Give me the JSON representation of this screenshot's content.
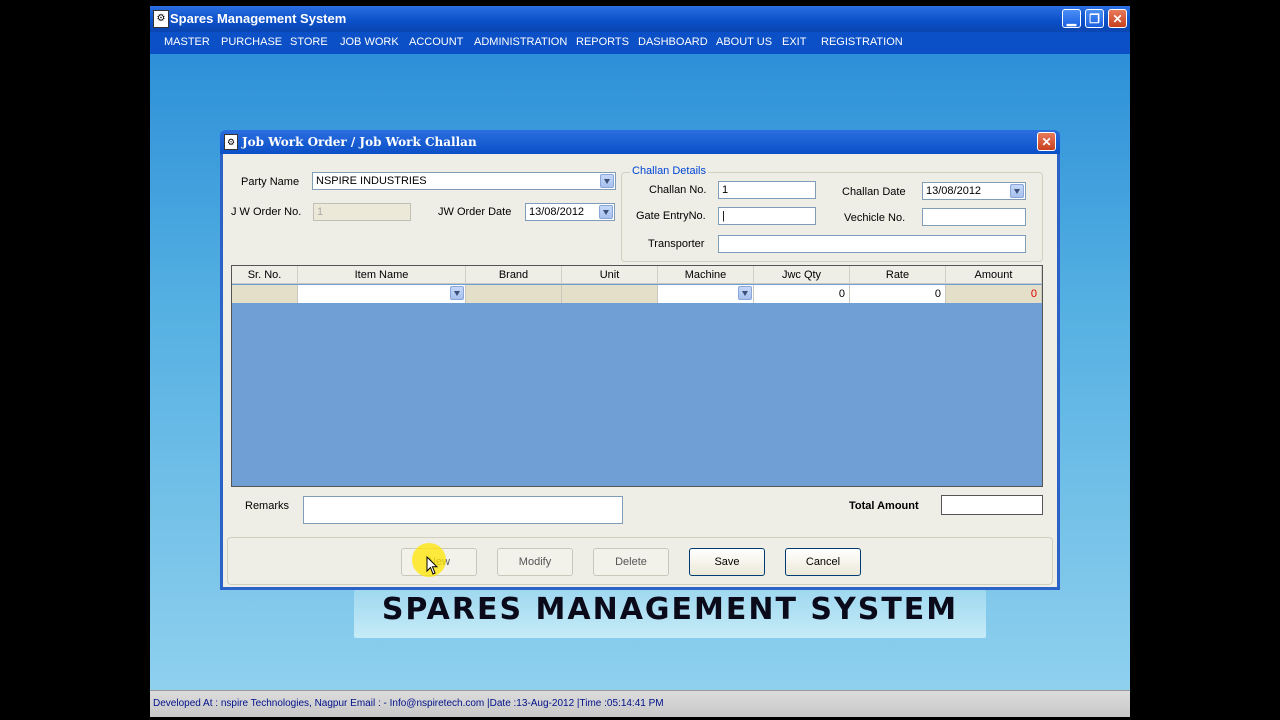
{
  "app": {
    "title": "Spares  Management System",
    "icon_text": "⚙",
    "min_glyph": "▁",
    "max_glyph": "❐",
    "close_glyph": "✕"
  },
  "menu": [
    "MASTER",
    "PURCHASE",
    "STORE",
    "JOB WORK",
    "ACCOUNT",
    "ADMINISTRATION",
    "REPORTS",
    "DASHBOARD",
    "ABOUT US",
    "EXIT",
    "REGISTRATION"
  ],
  "dialog": {
    "title": "Job Work Order / Job Work Challan",
    "close_glyph": "✕",
    "party_name_label": "Party Name",
    "party_name_value": "NSPIRE INDUSTRIES",
    "jw_order_no_label": "J W Order No.",
    "jw_order_no_value": "1",
    "jw_order_date_label": "JW Order Date",
    "jw_order_date_value": "13/08/2012",
    "challan": {
      "legend": "Challan Details",
      "challan_no_label": "Challan No.",
      "challan_no_value": "1",
      "challan_date_label": "Challan Date",
      "challan_date_value": "13/08/2012",
      "gate_entry_label": "Gate EntryNo.",
      "gate_entry_value": "|",
      "vehicle_no_label": "Vechicle No.",
      "vehicle_no_value": "",
      "transporter_label": "Transporter",
      "transporter_value": ""
    },
    "grid": {
      "columns": [
        "Sr. No.",
        "Item Name",
        "Brand",
        "Unit",
        "Machine",
        "Jwc Qty",
        "Rate",
        "Amount"
      ],
      "row": {
        "sr": "",
        "item": "",
        "brand": "",
        "unit": "",
        "machine": "",
        "qty": "0",
        "rate": "0",
        "amount": "0"
      }
    },
    "remarks_label": "Remarks",
    "remarks_value": "",
    "total_label": "Total Amount",
    "total_value": "",
    "buttons": {
      "new": "New",
      "modify": "Modify",
      "delete": "Delete",
      "save": "Save",
      "cancel": "Cancel"
    }
  },
  "banner": "SPARES MANAGEMENT SYSTEM",
  "status": "Developed At : nspire Technologies, Nagpur  Email : - Info@nspiretech.com   |Date :13-Aug-2012  |Time :05:14:41 PM",
  "colors": {
    "titlebar": "#0b4fc8",
    "grid_bg": "#6f9fd4",
    "amount_red": "#e00000"
  }
}
